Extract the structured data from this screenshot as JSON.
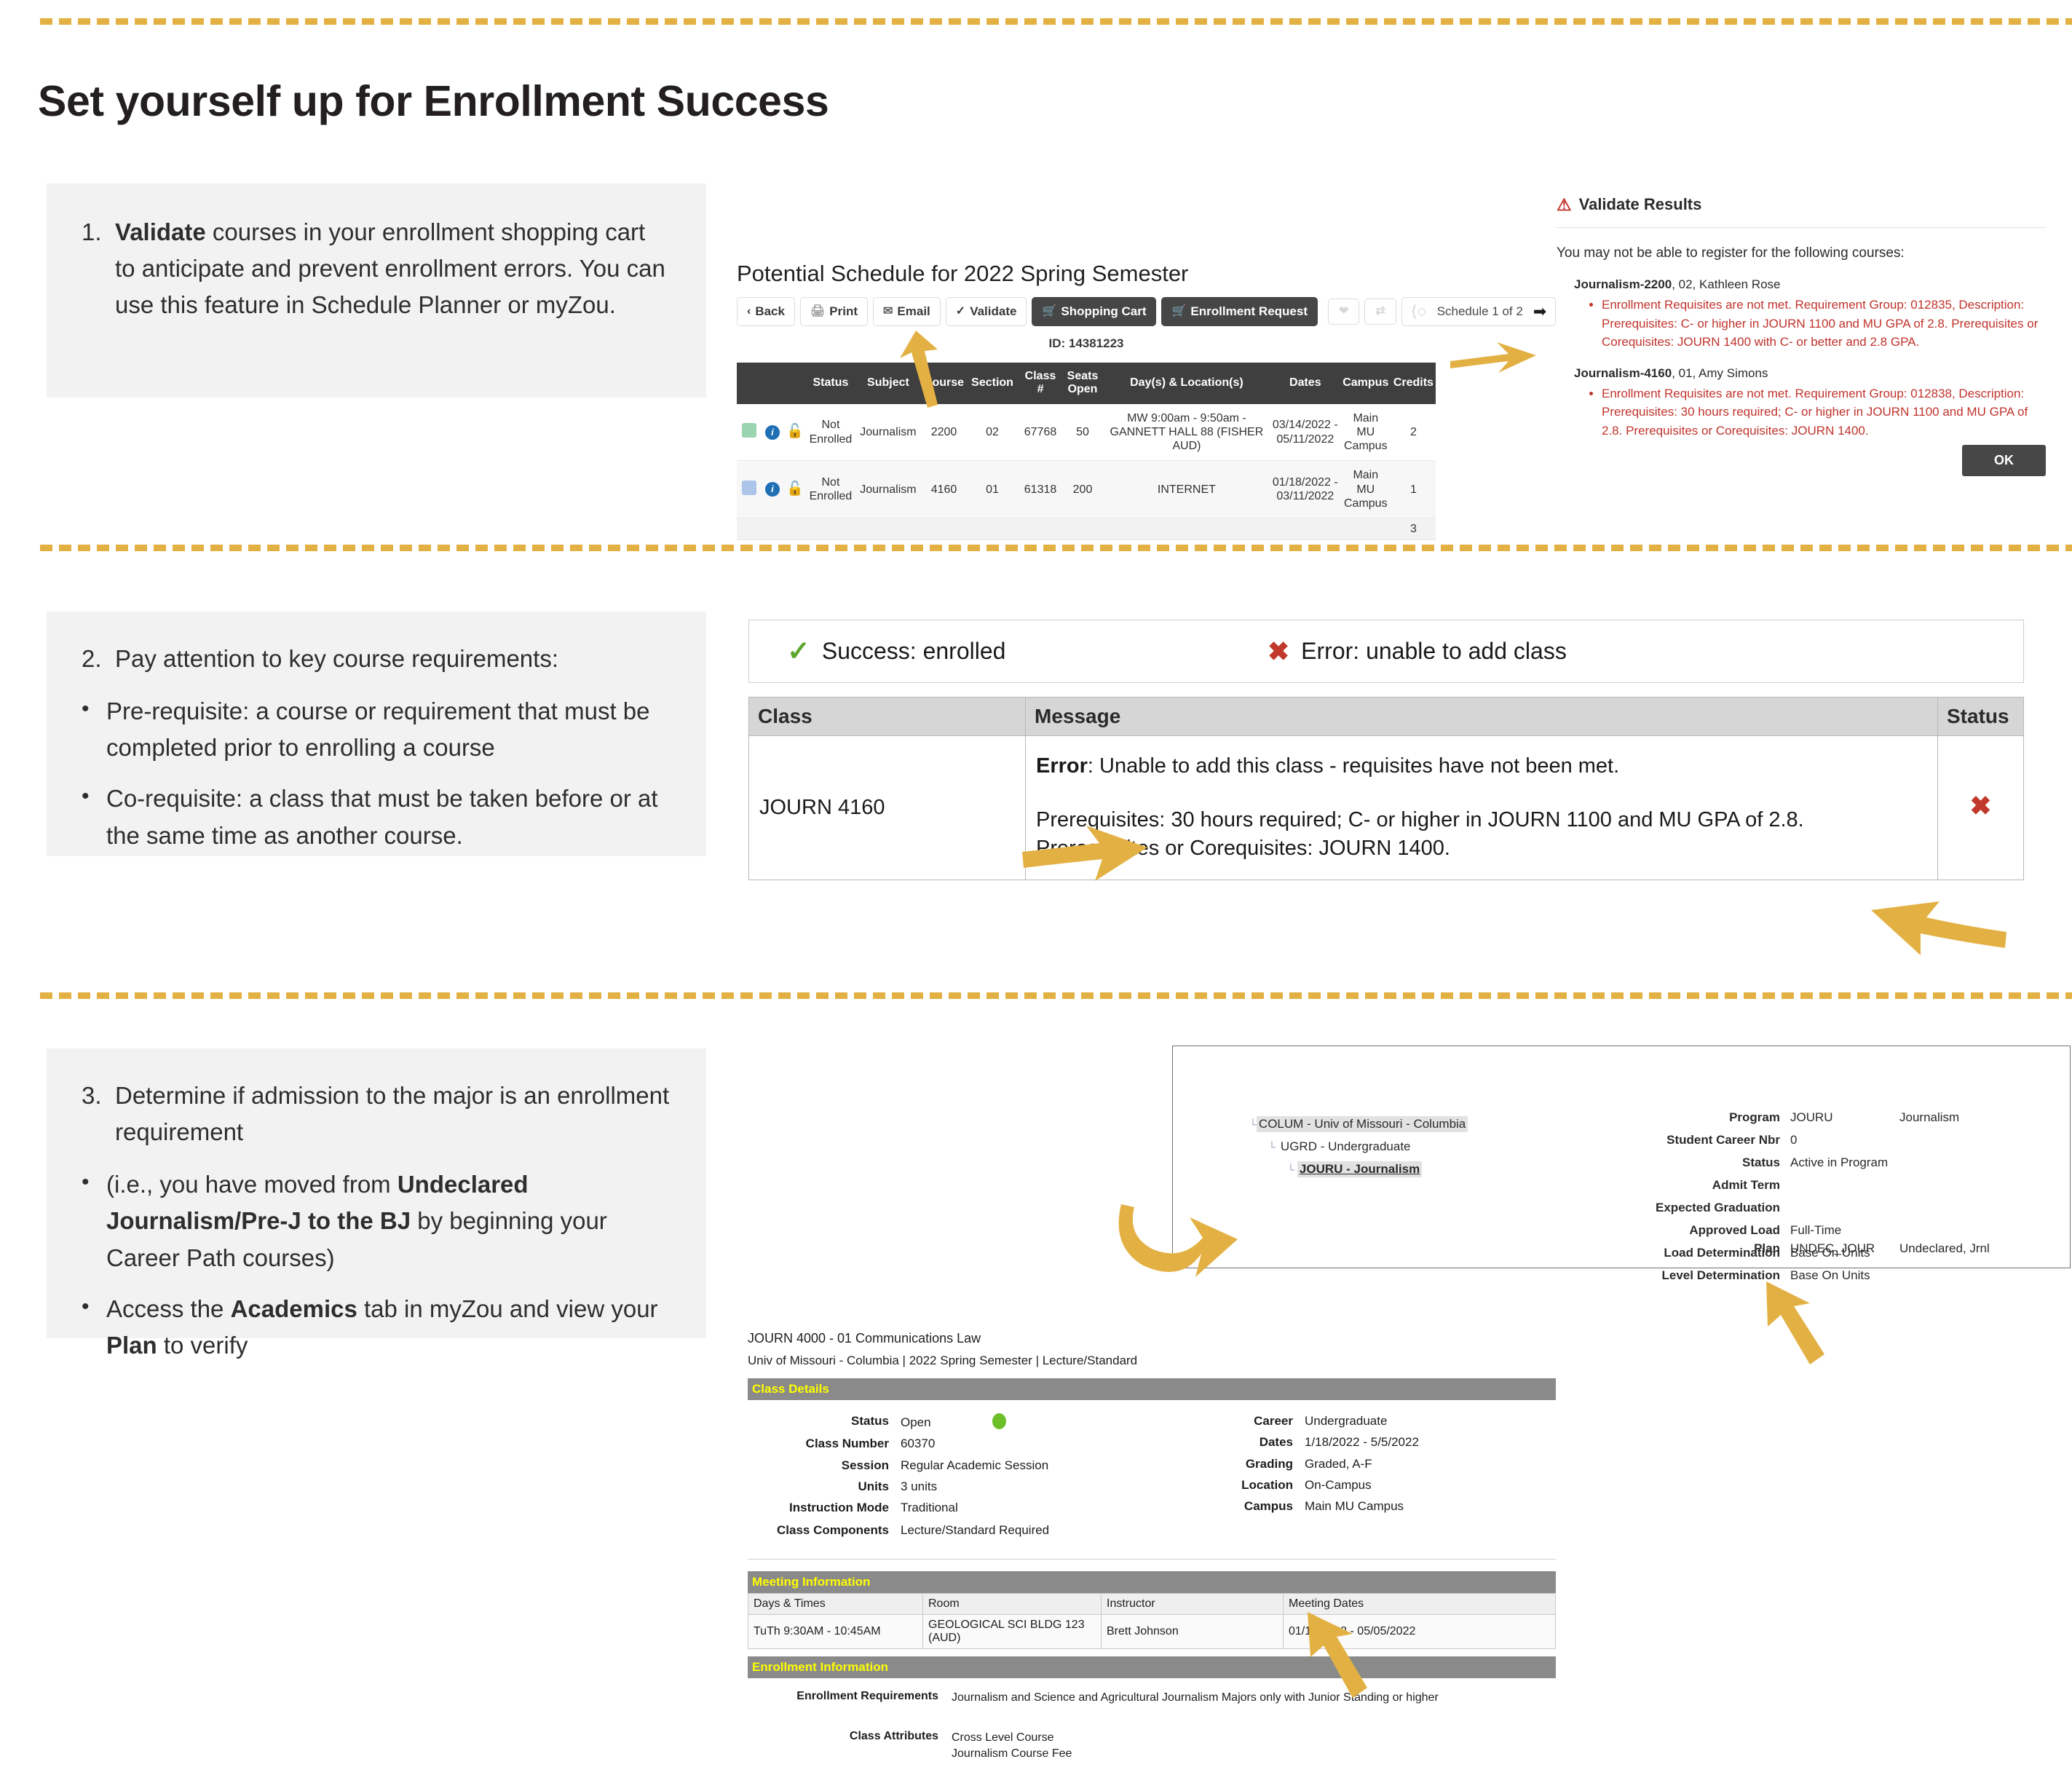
{
  "page": {
    "title": "Set yourself up for Enrollment Success",
    "accent_color": "#e3b143",
    "panel_bg": "#f2f2f2"
  },
  "steps": [
    {
      "number": "1.",
      "lead_bold": "Validate",
      "lead_rest": " courses in your enrollment shopping cart to anticipate and prevent enrollment errors. You can use this feature in Schedule Planner or myZou.",
      "bullets": []
    },
    {
      "number": "2.",
      "lead_bold": "",
      "lead_rest": "Pay attention to key course requirements:",
      "bullets": [
        "Pre-requisite: a course or requirement that must be completed prior to enrolling a course",
        "Co-requisite: a class that must be taken before or at the same time as another course."
      ]
    },
    {
      "number": "3.",
      "lead_bold": "",
      "lead_rest": "Determine if admission to the major is an enrollment requirement",
      "bullets": []
    }
  ],
  "step3_bullets": {
    "b1_pre": "(i.e., you have moved from ",
    "b1_bold": "Undeclared Journalism/Pre-J to the BJ",
    "b1_post": " by beginning your Career Path courses)",
    "b2_pre": "Access the ",
    "b2_bold1": "Academics",
    "b2_mid": " tab in myZou and view your ",
    "b2_bold2": "Plan",
    "b2_post": " to verify"
  },
  "schedule_planner": {
    "title": "Potential Schedule for 2022 Spring Semester",
    "buttons": [
      {
        "label": "Back",
        "icon": "chevron-left-icon",
        "style": "light"
      },
      {
        "label": "Print",
        "icon": "printer-icon",
        "style": "light"
      },
      {
        "label": "Email",
        "icon": "envelope-icon",
        "style": "light"
      },
      {
        "label": "Validate",
        "icon": "check-icon",
        "style": "light"
      },
      {
        "label": "Shopping Cart",
        "icon": "cart-icon",
        "style": "dark"
      },
      {
        "label": "Enrollment Request",
        "icon": "cart-icon",
        "style": "dark"
      }
    ],
    "favorite_icon": "heart-icon",
    "shuffle_icon": "shuffle-icon",
    "prev_icon": "circle-arrow-left-icon",
    "next_icon": "circle-arrow-right-icon",
    "pager_label": "Schedule 1 of 2",
    "id_label": "ID: 14381223",
    "columns": [
      "",
      "",
      "",
      "Status",
      "Subject",
      "Course",
      "Section",
      "Class #",
      "Seats Open",
      "Day(s) & Location(s)",
      "Dates",
      "Campus",
      "Credits"
    ],
    "rows": [
      {
        "swatch": "#9ad4b0",
        "info_icon": "info-icon",
        "lock_icon": "open-lock-icon",
        "status": "Not Enrolled",
        "subject": "Journalism",
        "course": "2200",
        "section": "02",
        "class_nbr": "67768",
        "seats_open": "50",
        "day_location": "MW 9:00am - 9:50am - GANNETT HALL 88 (FISHER AUD)",
        "dates": "03/14/2022 - 05/11/2022",
        "campus": "Main MU Campus",
        "credits": "2"
      },
      {
        "swatch": "#aec5ea",
        "info_icon": "info-icon",
        "lock_icon": "open-lock-icon",
        "status": "Not Enrolled",
        "subject": "Journalism",
        "course": "4160",
        "section": "01",
        "class_nbr": "61318",
        "seats_open": "200",
        "day_location": "INTERNET",
        "dates": "01/18/2022 - 03/11/2022",
        "campus": "Main MU Campus",
        "credits": "1"
      }
    ],
    "total_credits": "3"
  },
  "validate_results": {
    "heading": "Validate Results",
    "warn_icon": "warning-triangle-icon",
    "lead": "You may not be able to register for the following courses:",
    "courses": [
      {
        "code": "Journalism-2200",
        "rest": ", 02, Kathleen Rose",
        "messages": [
          "Enrollment Requisites are not met.  Requirement Group: 012835, Description: Prerequisites:   C- or higher in JOURN 1100 and MU GPA of 2.8. Prerequisites or Corequisites: JOURN 1400 with C- or better and 2.8 GPA."
        ]
      },
      {
        "code": "Journalism-4160",
        "rest": ", 01, Amy Simons",
        "messages": [
          "Enrollment Requisites are not met.  Requirement Group: 012838, Description: Prerequisites: 30 hours required; C- or higher in JOURN 1100 and MU GPA of 2.8.  Prerequisites or Corequisites: JOURN 1400."
        ]
      }
    ],
    "ok_label": "OK",
    "error_color": "#c0332c"
  },
  "legend": {
    "success_icon": "green-check-icon",
    "success_label": "Success: enrolled",
    "error_icon": "red-x-icon",
    "error_label": "Error: unable to add class"
  },
  "message_table": {
    "columns": [
      "Class",
      "Message",
      "Status"
    ],
    "row": {
      "class": "JOURN 4160",
      "message_bold": "Error",
      "message_rest": ": Unable to add this class - requisites have not been met.",
      "message_second": "Prerequisites: 30 hours required; C- or higher in JOURN 1100 and MU GPA of 2.8. Prerequisites or Corequisites: JOURN 1400.",
      "status_icon": "red-x-icon"
    }
  },
  "program_panel": {
    "tree": [
      "COLUM - Univ of Missouri - Columbia",
      "UGRD - Undergraduate",
      "JOURU - Journalism"
    ],
    "fields": [
      {
        "label": "Program",
        "value": "JOURU",
        "value2": "Journalism"
      },
      {
        "label": "Student Career Nbr",
        "value": "0",
        "value2": ""
      },
      {
        "label": "Status",
        "value": "Active in Program",
        "value2": ""
      },
      {
        "label": "Admit Term",
        "value": "",
        "value2": ""
      },
      {
        "label": "Expected Graduation",
        "value": "",
        "value2": ""
      },
      {
        "label": "Approved Load",
        "value": "Full-Time",
        "value2": ""
      },
      {
        "label": "Load Determination",
        "value": "Base On Units",
        "value2": ""
      },
      {
        "label": "Level Determination",
        "value": "Base On Units",
        "value2": ""
      }
    ],
    "plan": {
      "label": "Plan",
      "value": "UNDEC_JOUR",
      "value2": "Undeclared, Jrnl"
    }
  },
  "class_details": {
    "title": "JOURN 4000 - 01   Communications Law",
    "subtitle": "Univ of Missouri - Columbia | 2022 Spring Semester | Lecture/Standard",
    "section_label": "Class Details",
    "left_fields": [
      {
        "label": "Status",
        "value": "Open"
      },
      {
        "label": "Class Number",
        "value": "60370"
      },
      {
        "label": "Session",
        "value": "Regular Academic Session"
      },
      {
        "label": "Units",
        "value": "3 units"
      },
      {
        "label": "Instruction Mode",
        "value": "Traditional"
      },
      {
        "label": "Class Components",
        "value": "Lecture/Standard Required"
      }
    ],
    "status_dot_color": "#6dbf2a",
    "right_fields": [
      {
        "label": "Career",
        "value": "Undergraduate"
      },
      {
        "label": "Dates",
        "value": "1/18/2022 - 5/5/2022"
      },
      {
        "label": "Grading",
        "value": "Graded, A-F"
      },
      {
        "label": "Location",
        "value": "On-Campus"
      },
      {
        "label": "Campus",
        "value": "Main MU Campus"
      }
    ],
    "meeting_label": "Meeting Information",
    "meeting_columns": [
      "Days & Times",
      "Room",
      "Instructor",
      "Meeting Dates"
    ],
    "meeting_row": [
      "TuTh 9:30AM - 10:45AM",
      "GEOLOGICAL SCI BLDG 123 (AUD)",
      "Brett Johnson",
      "01/18/2022 - 05/05/2022"
    ],
    "enrollment_label": "Enrollment Information",
    "enrollment_fields": [
      {
        "label": "Enrollment Requirements",
        "value": "Journalism and Science and Agricultural Journalism Majors only with Junior Standing or higher"
      },
      {
        "label": "Class Attributes",
        "value": "Cross Level Course\nJournalism Course Fee"
      }
    ]
  }
}
